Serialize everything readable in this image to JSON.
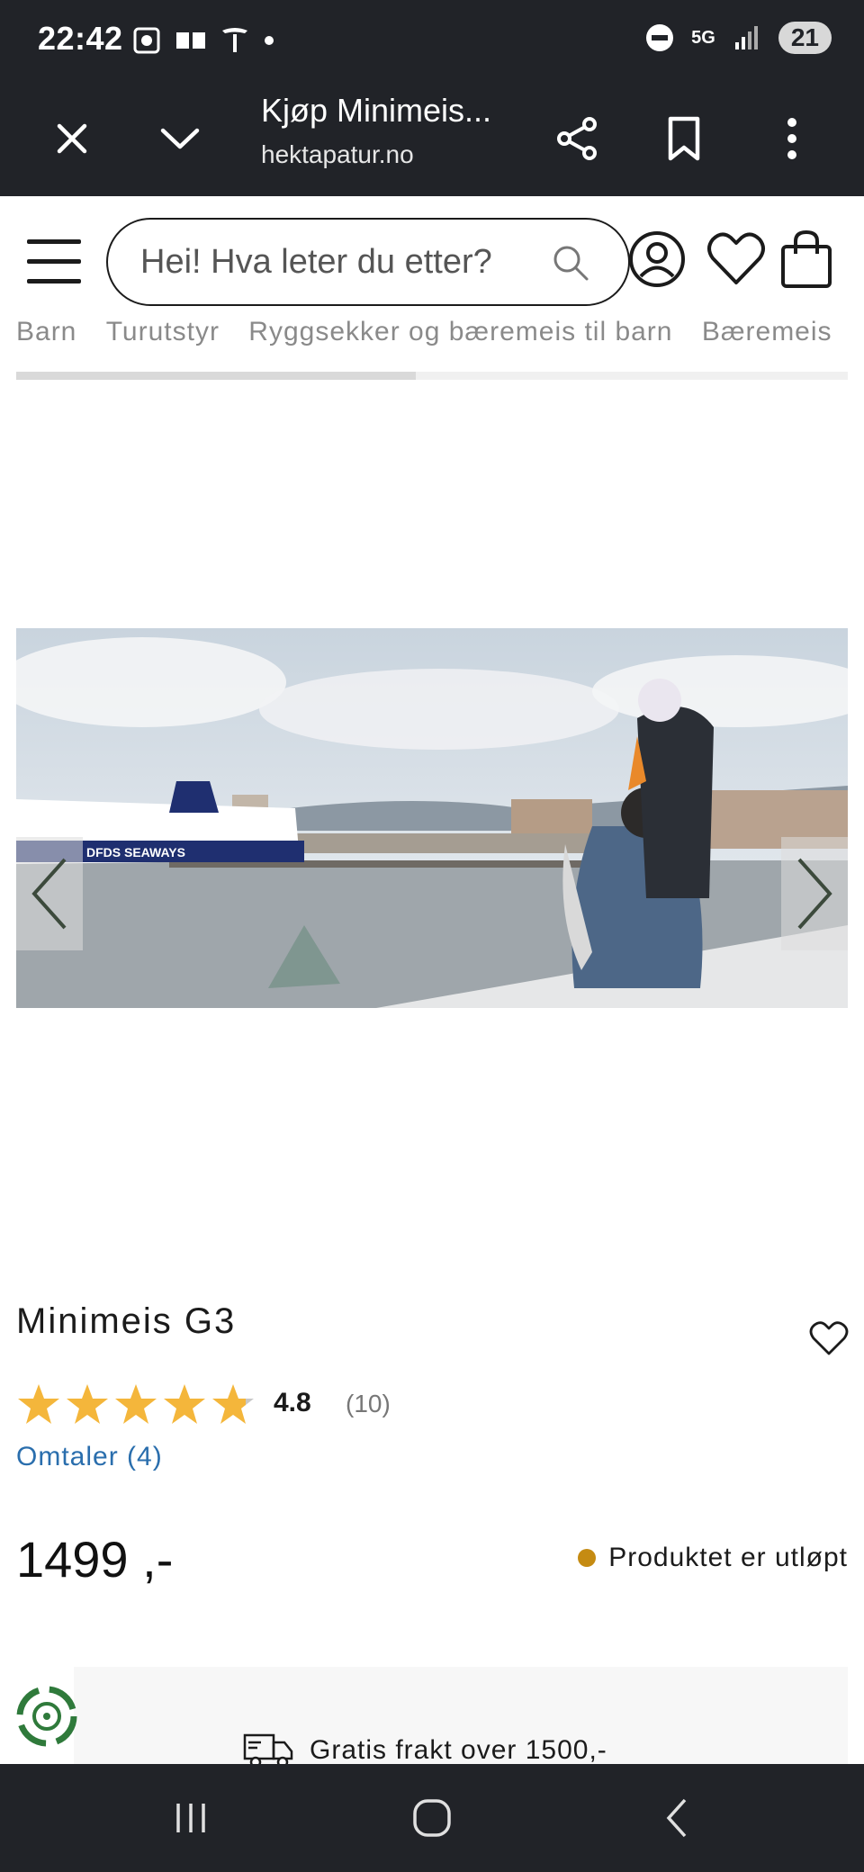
{
  "status_bar": {
    "time": "22:42",
    "battery": "21",
    "network": "5G"
  },
  "browser": {
    "tab_title": "Kjøp Minimeis...",
    "url": "hektapatur.no"
  },
  "search": {
    "placeholder": "Hei! Hva leter du etter?"
  },
  "breadcrumb": [
    "Barn",
    "Turutstyr",
    "Ryggsekker og bæremeis til barn",
    "Bæremeis"
  ],
  "breadcrumb_scroll_progress": 0.48,
  "product": {
    "title": "Minimeis G3",
    "rating_value": "4.8",
    "rating_stars": 4.8,
    "rating_count": "(10)",
    "reviews_link": "Omtaler (4)",
    "price": "1499 ,-",
    "status_text": "Produktet er utløpt",
    "status_color": "#c58b12"
  },
  "image": {
    "ship_label": "DFDS SEAWAYS"
  },
  "shipping": {
    "text": "Gratis frakt over 1500,-"
  },
  "colors": {
    "dark_bar": "#212328",
    "link": "#2a6ead",
    "star": "#f4b63b",
    "eco_green": "#2f7a3b"
  },
  "icons": {
    "close": "close-icon",
    "dropdown": "chevron-down-icon",
    "share": "share-icon",
    "bookmark": "bookmark-icon",
    "more": "more-vertical-icon",
    "menu": "hamburger-icon",
    "search": "search-icon",
    "account": "user-icon",
    "wishlist": "heart-icon",
    "cart": "shopping-bag-icon"
  }
}
